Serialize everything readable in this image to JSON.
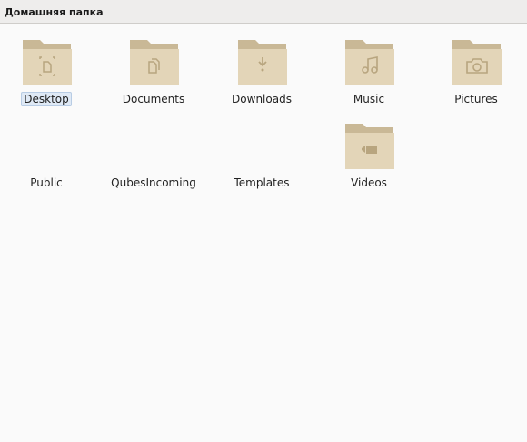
{
  "header": {
    "title": "Домашняя папка"
  },
  "items": [
    {
      "label": "Desktop",
      "icon": "desktop-folder-icon",
      "selected": true
    },
    {
      "label": "Documents",
      "icon": "documents-folder-icon"
    },
    {
      "label": "Downloads",
      "icon": "downloads-folder-icon"
    },
    {
      "label": "Music",
      "icon": "music-folder-icon"
    },
    {
      "label": "Pictures",
      "icon": "pictures-folder-icon"
    },
    {
      "label": "Public",
      "icon": null
    },
    {
      "label": "QubesIncoming",
      "icon": null
    },
    {
      "label": "Templates",
      "icon": null
    },
    {
      "label": "Videos",
      "icon": "videos-folder-icon"
    }
  ],
  "colors": {
    "folder_back": "#c9b896",
    "folder_front": "#e3d5b8",
    "folder_symbol": "#b8a57f",
    "selection_bg": "#dfe9f5"
  }
}
